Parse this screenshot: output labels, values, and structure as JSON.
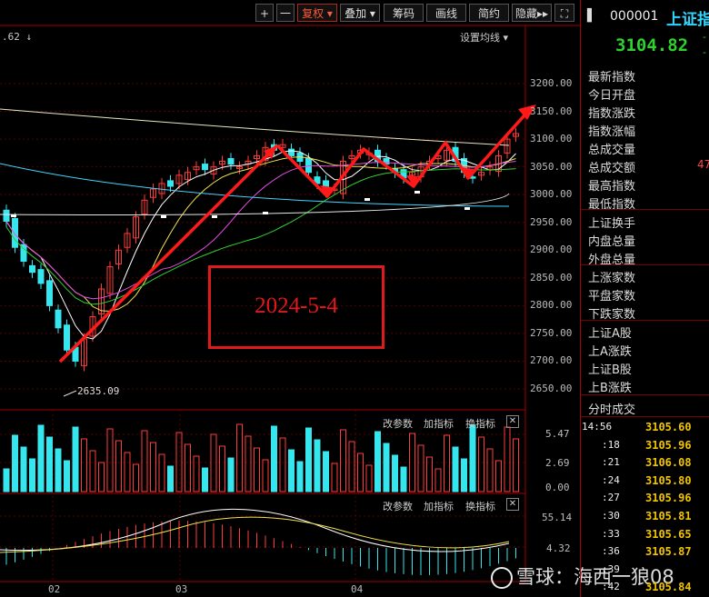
{
  "toolbar": {
    "plus": "+",
    "minus": "一",
    "fuquan": "复权",
    "diejia": "叠加",
    "choumа": "筹码",
    "huaxian": "画线",
    "jianyue": "简约",
    "yincang": "隐藏"
  },
  "top_left_value": ".62",
  "settings_label": "设置均线",
  "price_axis": [
    "3200.00",
    "3150.00",
    "3100.00",
    "3050.00",
    "3000.00",
    "2950.00",
    "2900.00",
    "2850.00",
    "2800.00",
    "2750.00",
    "2700.00",
    "2650.00"
  ],
  "low_marker": "2635.09",
  "annotation_date": "2024-5-4",
  "volume_panel": {
    "buttons": [
      "改参数",
      "加指标",
      "换指标"
    ],
    "axis": [
      "5.47",
      "2.69",
      "0.00"
    ]
  },
  "macd_panel": {
    "buttons": [
      "改参数",
      "加指标",
      "换指标"
    ],
    "axis": [
      "55.14",
      "4.32"
    ]
  },
  "month_labels": [
    "02",
    "03",
    "04"
  ],
  "watermark": "雪球：海西一狼08",
  "quote": {
    "code": "000001",
    "name": "上证指",
    "price": "3104.82",
    "side_marks": [
      "-",
      "-"
    ],
    "fields": [
      "最新指数",
      "今日开盘",
      "指数涨跌",
      "指数涨幅",
      "总成交量",
      "总成交额",
      "最高指数",
      "最低指数",
      "上证换手",
      "内盘总量",
      "外盘总量",
      "上涨家数",
      "平盘家数",
      "下跌家数",
      "上证A股",
      "上A涨跌",
      "上证B股",
      "上B涨跌"
    ],
    "field_vals": {
      "总成交额": "47"
    },
    "ticks_title": "分时成交",
    "ticks": [
      {
        "t": "14:56",
        "p": "3105.60"
      },
      {
        "t": ":18",
        "p": "3105.96"
      },
      {
        "t": ":21",
        "p": "3106.08"
      },
      {
        "t": ":24",
        "p": "3105.80"
      },
      {
        "t": ":27",
        "p": "3105.96"
      },
      {
        "t": ":30",
        "p": "3105.81"
      },
      {
        "t": ":33",
        "p": "3105.65"
      },
      {
        "t": ":36",
        "p": "3105.87"
      },
      {
        "t": ":39",
        "p": ""
      },
      {
        "t": ":42",
        "p": "3105.84"
      }
    ]
  },
  "colors": {
    "up": "#ff3b3b",
    "down": "#35e6ee",
    "arrow": "#ff1a1a",
    "ma5": "#ffffff",
    "ma10": "#f3e34a",
    "ma20": "#e44be4",
    "ma30": "#2fd12f",
    "ma60": "#3fd7ff",
    "ma120": "#e6e6e6"
  }
}
